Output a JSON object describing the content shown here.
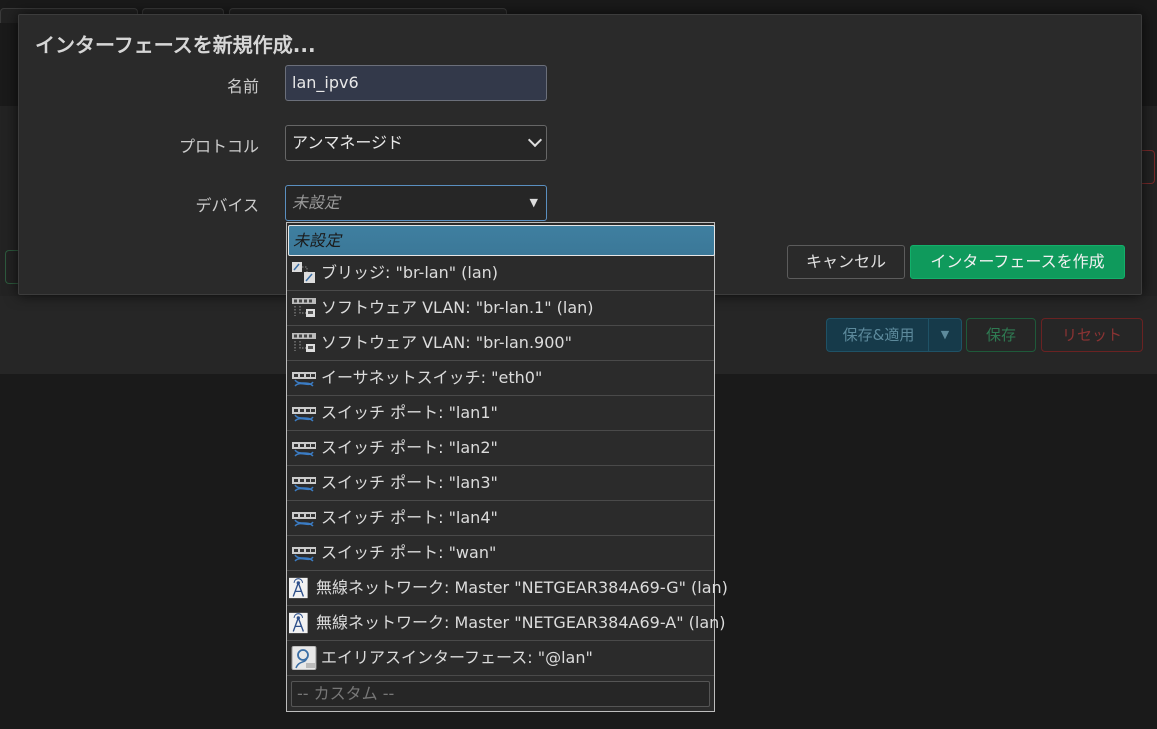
{
  "modal": {
    "title": "インターフェースを新規作成...",
    "fields": {
      "name_label": "名前",
      "name_value": "lan_ipv6",
      "protocol_label": "プロトコル",
      "protocol_value": "アンマネージド",
      "device_label": "デバイス",
      "device_value": "未設定"
    },
    "buttons": {
      "cancel": "キャンセル",
      "create": "インターフェースを作成"
    }
  },
  "dropdown": {
    "selected": "未設定",
    "items": [
      {
        "label": "ブリッジ: \"br-lan\" (lan)",
        "icon": "bridge-icon"
      },
      {
        "label": "ソフトウェア VLAN: \"br-lan.1\" (lan)",
        "icon": "vlan-icon"
      },
      {
        "label": "ソフトウェア VLAN: \"br-lan.900\"",
        "icon": "vlan-icon"
      },
      {
        "label": "イーサネットスイッチ: \"eth0\"",
        "icon": "ethernet-icon"
      },
      {
        "label": "スイッチ ポート: \"lan1\"",
        "icon": "ethernet-icon"
      },
      {
        "label": "スイッチ ポート: \"lan2\"",
        "icon": "ethernet-icon"
      },
      {
        "label": "スイッチ ポート: \"lan3\"",
        "icon": "ethernet-icon"
      },
      {
        "label": "スイッチ ポート: \"lan4\"",
        "icon": "ethernet-icon"
      },
      {
        "label": "スイッチ ポート: \"wan\"",
        "icon": "ethernet-icon"
      },
      {
        "label": "無線ネットワーク: Master \"NETGEAR384A69-G\" (lan)",
        "icon": "wifi-icon"
      },
      {
        "label": "無線ネットワーク: Master \"NETGEAR384A69-A\" (lan)",
        "icon": "wifi-icon"
      },
      {
        "label": "エイリアスインターフェース: \"@lan\"",
        "icon": "alias-icon"
      }
    ],
    "custom_placeholder": "-- カスタム --"
  },
  "background": {
    "buttons": {
      "save_apply": "保存&適用",
      "save": "保存",
      "reset": "リセット"
    }
  }
}
